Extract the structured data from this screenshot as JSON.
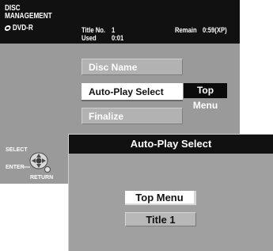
{
  "header": {
    "title_line1": "DISC",
    "title_line2": "MANAGEMENT",
    "media": "DVD-R",
    "title_no_label": "Title No.",
    "title_no_value": "1",
    "used_label": "Used",
    "used_value": "0:01",
    "remain_label": "Remain",
    "remain_value": "0:59(XP)"
  },
  "menu": {
    "items": [
      {
        "label": "Disc Name"
      },
      {
        "label": "Auto-Play Select"
      },
      {
        "label": "Finalize"
      }
    ],
    "current_value": "Top Menu"
  },
  "navigation": {
    "select_label": "SELECT",
    "enter_label": "ENTER",
    "return_label": "RETURN"
  },
  "popup": {
    "title": "Auto-Play Select",
    "options": [
      {
        "label": "Top Menu"
      },
      {
        "label": "Title 1"
      }
    ]
  }
}
